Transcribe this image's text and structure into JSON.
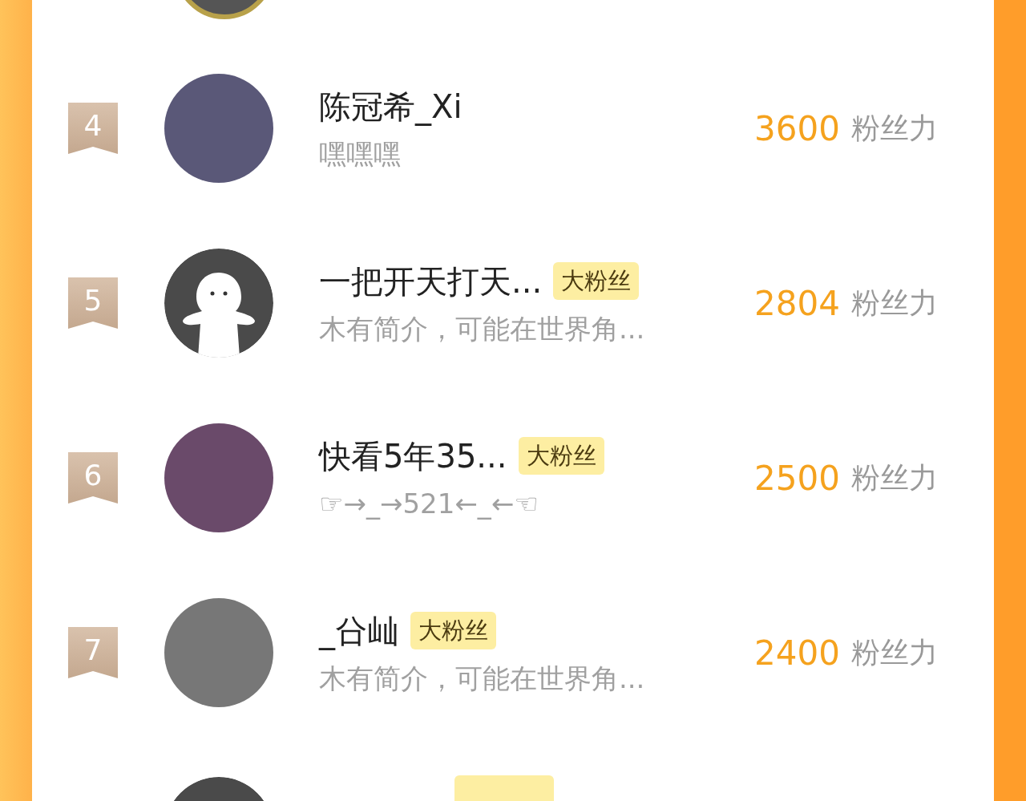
{
  "rows": [
    {
      "rank": "4",
      "kind": "photo",
      "name": "陈冠希_Xi",
      "description": "嘿嘿嘿",
      "score": "3600",
      "score_unit": "粉丝力"
    },
    {
      "rank": "5",
      "kind": "default",
      "name": "一把开天打天...",
      "badge": "大粉丝",
      "description": "木有简介，可能在世界角...",
      "score": "2804",
      "score_unit": "粉丝力"
    },
    {
      "rank": "6",
      "kind": "photo",
      "name": "快看5年35...",
      "badge": "大粉丝",
      "description": "☞→_→521←_←☜",
      "score": "2500",
      "score_unit": "粉丝力"
    },
    {
      "rank": "7",
      "kind": "photo",
      "name": "_㕣屾",
      "badge": "大粉丝",
      "description": "木有简介，可能在世界角...",
      "score": "2400",
      "score_unit": "粉丝力"
    }
  ]
}
